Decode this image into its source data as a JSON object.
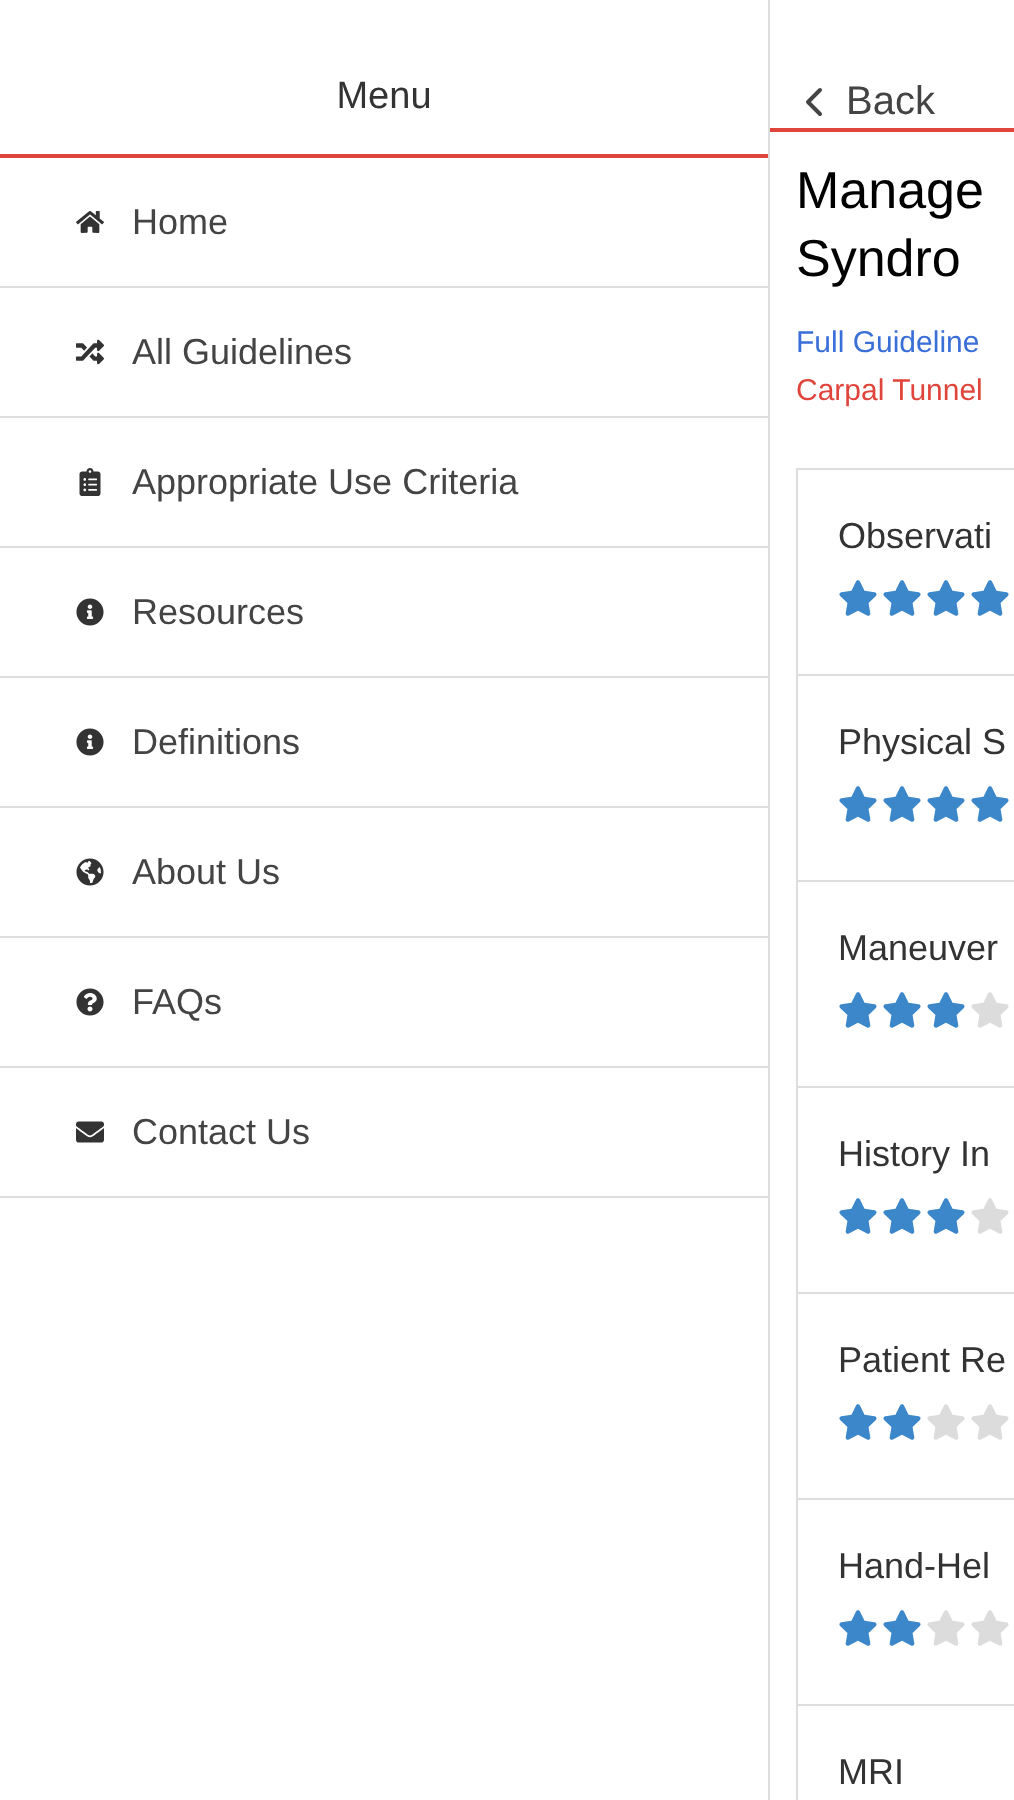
{
  "menu": {
    "title": "Menu",
    "items": [
      {
        "label": "Home"
      },
      {
        "label": "All Guidelines"
      },
      {
        "label": "Appropriate Use Criteria"
      },
      {
        "label": "Resources"
      },
      {
        "label": "Definitions"
      },
      {
        "label": "About Us"
      },
      {
        "label": "FAQs"
      },
      {
        "label": "Contact Us"
      }
    ]
  },
  "detail": {
    "back": "Back",
    "title": [
      "Manage",
      "Syndro"
    ],
    "link": "Full Guideline",
    "tag": "Carpal Tunnel",
    "cards": [
      {
        "label": "Observati",
        "stars": 4
      },
      {
        "label": "Physical S",
        "stars": 4
      },
      {
        "label": "Maneuver",
        "stars": 3
      },
      {
        "label": "History In",
        "stars": 3
      },
      {
        "label": "Patient Re",
        "stars": 2
      },
      {
        "label": "Hand-Hel",
        "stars": 2
      },
      {
        "label": "MRI"
      }
    ]
  }
}
